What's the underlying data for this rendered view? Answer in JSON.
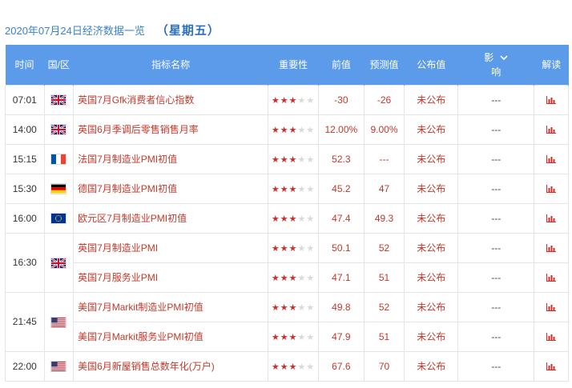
{
  "header": {
    "date_title": "2020年07月24日经济数据一览",
    "weekday": "（星期五）"
  },
  "columns": {
    "time": "时间",
    "region": "国/区",
    "indicator": "指标名称",
    "importance": "重要性",
    "previous": "前值",
    "forecast": "预测值",
    "actual": "公布值",
    "impact_top": "影",
    "impact_bottom": "响",
    "interpret": "解读"
  },
  "icons": {
    "impact_dropdown": "chevron-down-icon",
    "interpret": "bar-chart-icon",
    "star": "star-icon"
  },
  "colors": {
    "header_bg": "#5b9bea",
    "accent_red": "#c0392b",
    "title_blue": "#3b82c8"
  },
  "rows": [
    {
      "time": "07:01",
      "flag": "uk",
      "indicator": "英国7月Gfk消费者信心指数",
      "stars": 3,
      "previous": "-30",
      "forecast": "-26",
      "actual": "未公布",
      "impact": "---"
    },
    {
      "time": "14:00",
      "flag": "uk",
      "indicator": "英国6月季调后零售销售月率",
      "stars": 3,
      "previous": "12.00%",
      "forecast": "9.00%",
      "actual": "未公布",
      "impact": "---"
    },
    {
      "time": "15:15",
      "flag": "fr",
      "indicator": "法国7月制造业PMI初值",
      "stars": 3,
      "previous": "52.3",
      "forecast": "---",
      "actual": "未公布",
      "impact": "---"
    },
    {
      "time": "15:30",
      "flag": "de",
      "indicator": "德国7月制造业PMI初值",
      "stars": 3,
      "previous": "45.2",
      "forecast": "47",
      "actual": "未公布",
      "impact": "---"
    },
    {
      "time": "16:00",
      "flag": "eu",
      "indicator": "欧元区7月制造业PMI初值",
      "stars": 3,
      "previous": "47.4",
      "forecast": "49.3",
      "actual": "未公布",
      "impact": "---"
    },
    {
      "time": "16:30",
      "flag": "uk",
      "indicator": "英国7月制造业PMI",
      "stars": 3,
      "previous": "50.1",
      "forecast": "52",
      "actual": "未公布",
      "impact": "---"
    },
    {
      "time": "",
      "flag": "",
      "indicator": "英国7月服务业PMI",
      "stars": 3,
      "previous": "47.1",
      "forecast": "51",
      "actual": "未公布",
      "impact": "---"
    },
    {
      "time": "21:45",
      "flag": "us",
      "indicator": "美国7月Markit制造业PMI初值",
      "stars": 3,
      "previous": "49.8",
      "forecast": "52",
      "actual": "未公布",
      "impact": "---"
    },
    {
      "time": "",
      "flag": "",
      "indicator": "美国7月Markit服务业PMI初值",
      "stars": 3,
      "previous": "47.9",
      "forecast": "51",
      "actual": "未公布",
      "impact": "---"
    },
    {
      "time": "22:00",
      "flag": "us",
      "indicator": "美国6月新屋销售总数年化(万户)",
      "stars": 3,
      "previous": "67.6",
      "forecast": "70",
      "actual": "未公布",
      "impact": "---"
    }
  ]
}
